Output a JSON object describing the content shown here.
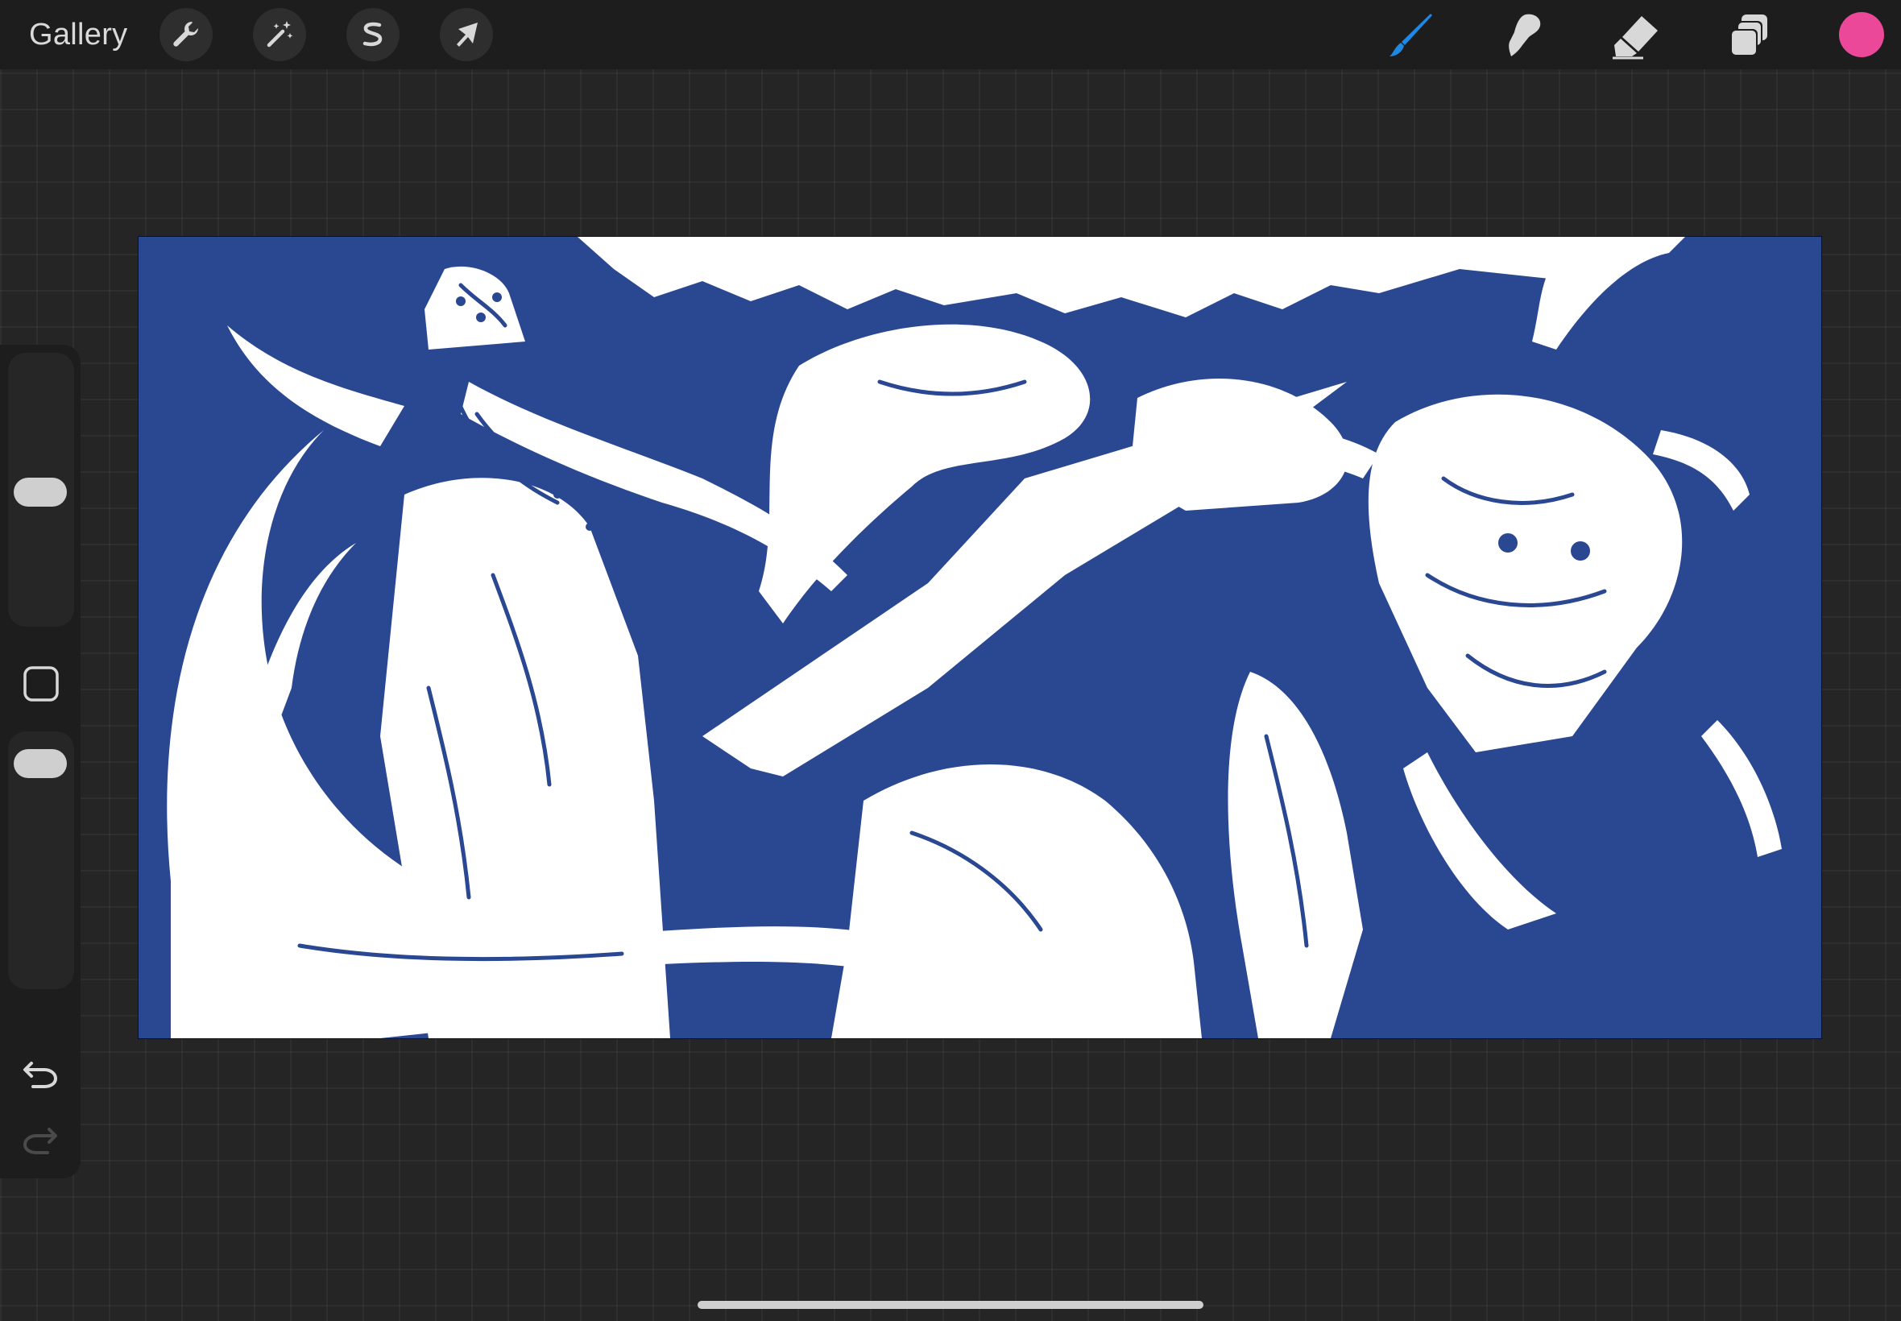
{
  "toolbar": {
    "gallery_label": "Gallery",
    "left_tools": [
      {
        "name": "actions",
        "icon": "wrench-icon"
      },
      {
        "name": "adjustments",
        "icon": "magic-wand-icon"
      },
      {
        "name": "selection",
        "icon": "selection-s-icon"
      },
      {
        "name": "transform",
        "icon": "arrow-cursor-icon"
      }
    ],
    "right_tools": [
      {
        "name": "brush",
        "icon": "brush-icon",
        "active": true
      },
      {
        "name": "smudge",
        "icon": "smudge-icon",
        "active": false
      },
      {
        "name": "eraser",
        "icon": "eraser-icon",
        "active": false
      },
      {
        "name": "layers",
        "icon": "layers-icon",
        "active": false
      }
    ],
    "current_color": "#ec4899",
    "active_color": "#1e88e5",
    "icon_color": "#d8d8d8"
  },
  "sidebar": {
    "brush_size_level": 0.5,
    "opacity_level": 1.0,
    "modify_button": "modify-square-icon",
    "undo_icon": "undo-icon",
    "redo_icon": "redo-icon"
  },
  "canvas": {
    "background_color": "#2a4792",
    "line_color": "#ffffff",
    "artwork": "wizard-and-dragons-illustration"
  },
  "colors": {
    "app_background": "#252525",
    "bar_background": "#1d1d1d"
  }
}
